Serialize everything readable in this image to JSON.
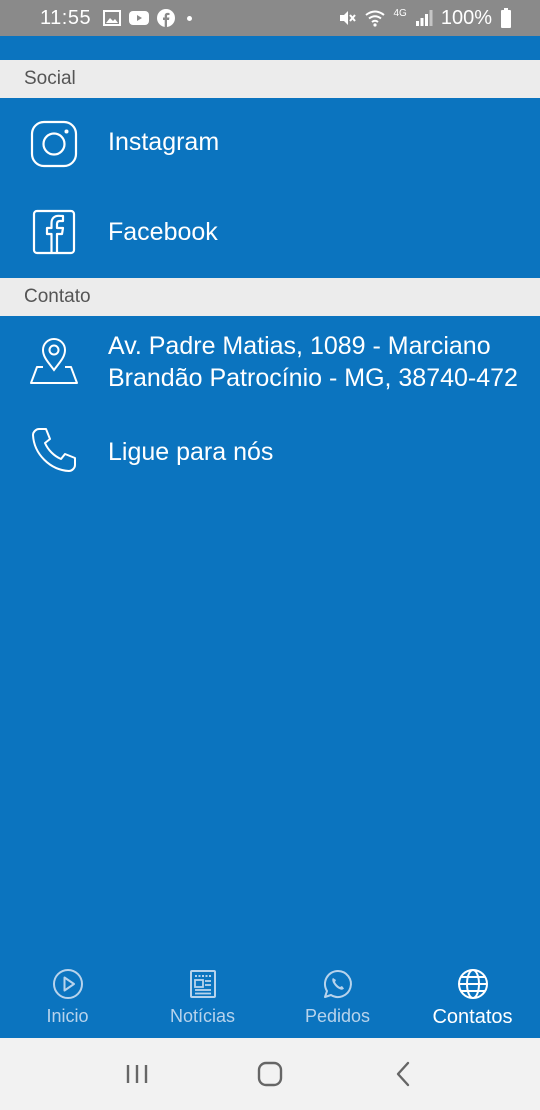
{
  "status_bar": {
    "time": "11:55",
    "battery": "100%",
    "network": "4G"
  },
  "sections": {
    "social_header": "Social",
    "contact_header": "Contato"
  },
  "social": [
    {
      "label": "Instagram",
      "icon": "instagram-icon"
    },
    {
      "label": "Facebook",
      "icon": "facebook-icon"
    }
  ],
  "contact": {
    "address_line1": "Av. Padre Matias, 1089 - Marciano",
    "address_line2": "Brandão Patrocínio - MG, 38740-472",
    "phone_label": "Ligue para nós"
  },
  "bottom_nav": [
    {
      "label": "Inicio",
      "icon": "play-circle-icon"
    },
    {
      "label": "Notícias",
      "icon": "newspaper-icon"
    },
    {
      "label": "Pedidos",
      "icon": "whatsapp-icon"
    },
    {
      "label": "Contatos",
      "icon": "globe-icon",
      "active": true
    }
  ],
  "colors": {
    "primary": "#0b74bf",
    "section_header_bg": "#ececec",
    "status_bar_bg": "#8a8a8a",
    "system_nav_bg": "#f2f2f2"
  }
}
